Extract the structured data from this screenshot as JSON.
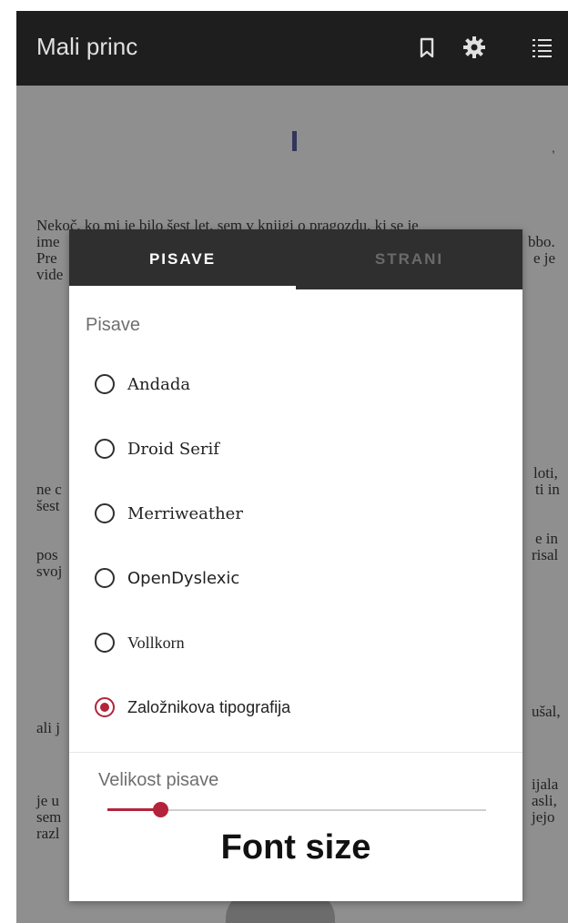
{
  "app": {
    "title": "Mali princ"
  },
  "toolbar": {
    "bookmark_icon": "bookmark-icon",
    "settings_icon": "gear-icon",
    "toc_icon": "list-icon"
  },
  "reader": {
    "chapter_mark": "I",
    "trailing_mark": ",",
    "lines": [
      {
        "text": "Nekoč, ko mi je bilo šest let, sem v knjigi o pragozdu, ki se je"
      },
      {
        "text": "ime"
      },
      {
        "text": "Pre"
      },
      {
        "text": "vide"
      },
      {
        "text": "bbo."
      },
      {
        "text": "e je"
      },
      {
        "text": "loti,"
      },
      {
        "text": "ne c"
      },
      {
        "text": "ti in"
      },
      {
        "text": "šest"
      },
      {
        "text": "e in"
      },
      {
        "text": "pos"
      },
      {
        "text": "risal"
      },
      {
        "text": "svoj"
      },
      {
        "text": "ušal,"
      },
      {
        "text": "ali j"
      },
      {
        "text": "ijala"
      },
      {
        "text": "je u"
      },
      {
        "text": "asli,"
      },
      {
        "text": "sem"
      },
      {
        "text": "jejo"
      },
      {
        "text": "razl"
      }
    ]
  },
  "dialog": {
    "tabs": [
      {
        "label": "PISAVE",
        "active": true
      },
      {
        "label": "STRANI",
        "active": false
      }
    ],
    "fonts_title": "Pisave",
    "fonts": [
      {
        "label": "Andada",
        "checked": false
      },
      {
        "label": "Droid Serif",
        "checked": false
      },
      {
        "label": "Merriweather",
        "checked": false
      },
      {
        "label": "OpenDyslexic",
        "checked": false
      },
      {
        "label": "Vollkorn",
        "checked": false
      },
      {
        "label": "Založnikova tipografija",
        "checked": true
      }
    ],
    "size_title": "Velikost pisave",
    "size_level": 0.14,
    "preview": "Font size"
  },
  "colors": {
    "accent": "#b3243a",
    "appbar": "#1e1e1e",
    "tabs": "#2f2f2f"
  }
}
